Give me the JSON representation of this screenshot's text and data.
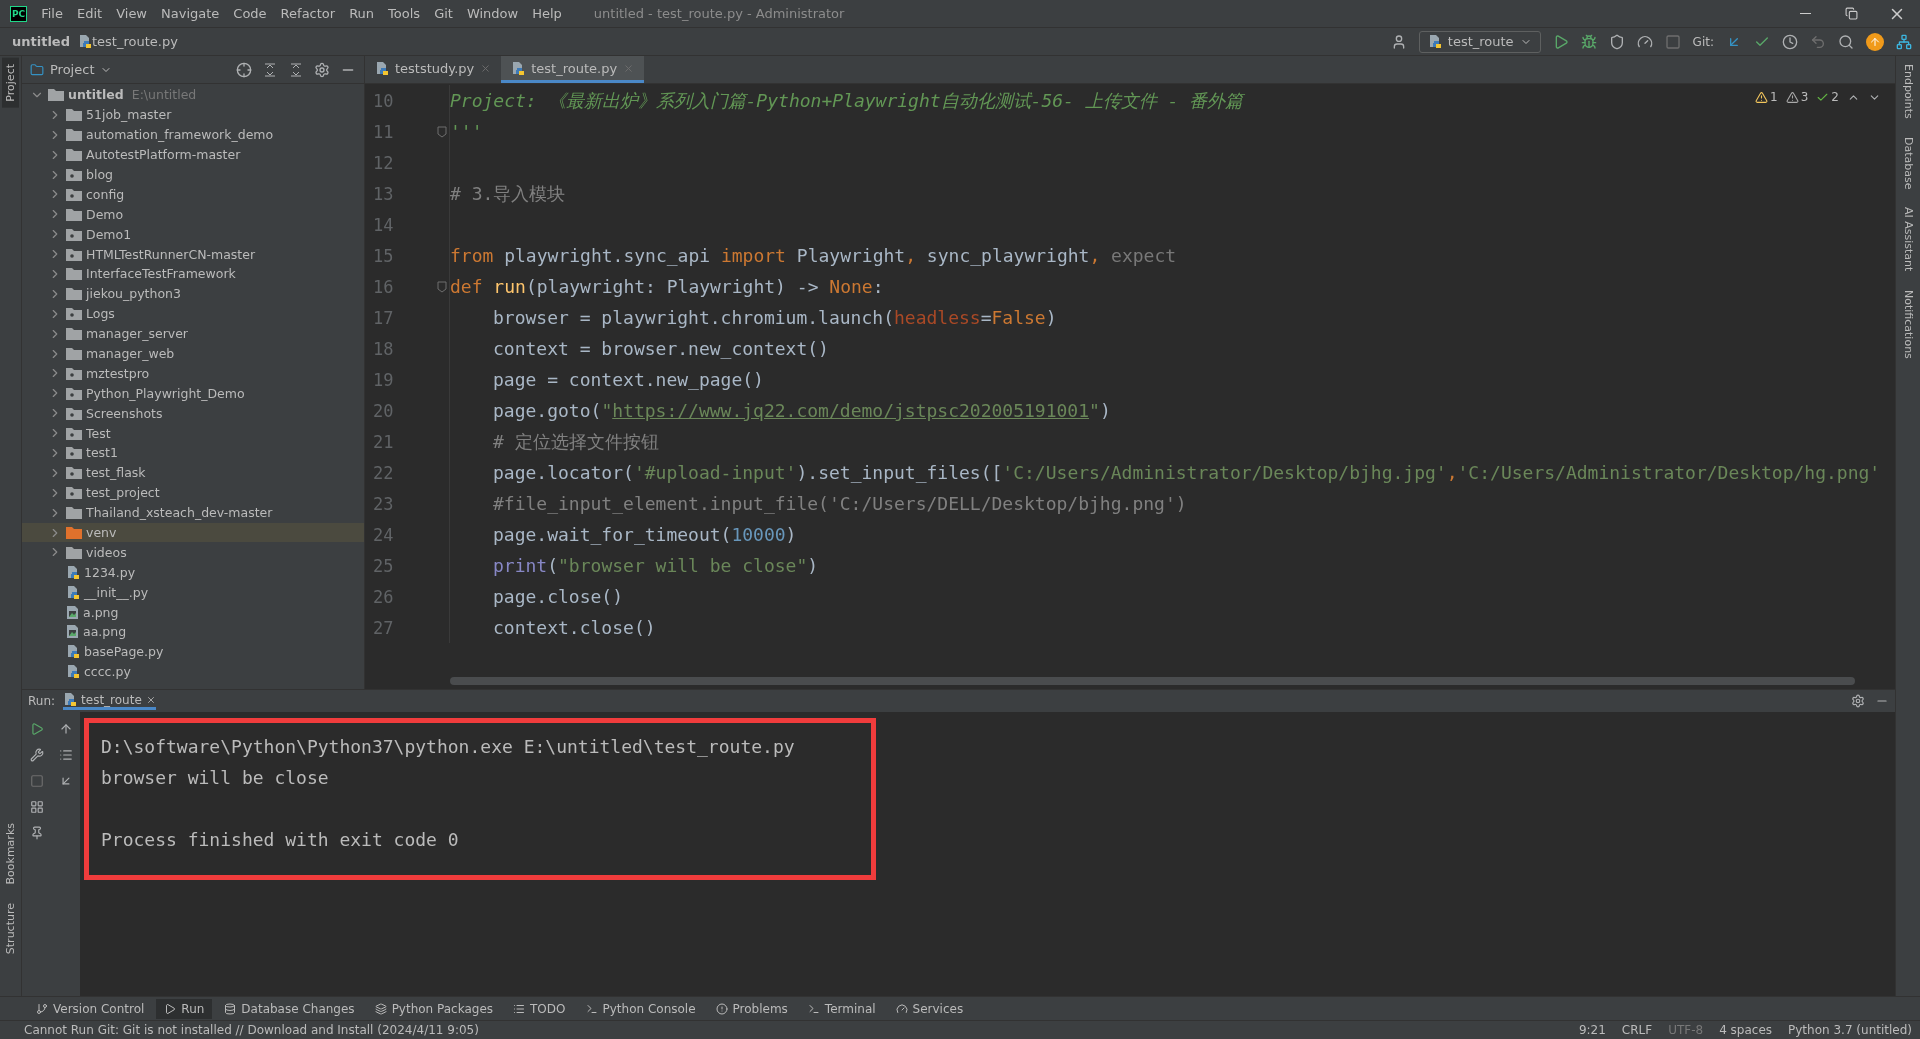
{
  "window": {
    "logo": "PC",
    "title": "untitled - test_route.py - Administrator"
  },
  "menu": [
    "File",
    "Edit",
    "View",
    "Navigate",
    "Code",
    "Refactor",
    "Run",
    "Tools",
    "Git",
    "Window",
    "Help"
  ],
  "breadcrumb": [
    "untitled",
    "test_route.py"
  ],
  "toolbar": {
    "run_config": "test_route",
    "git_label": "Git:"
  },
  "left_strip": [
    {
      "label": "Project",
      "selected": true
    },
    {
      "label": "Bookmarks",
      "selected": false
    },
    {
      "label": "Structure",
      "selected": false
    }
  ],
  "project_panel": {
    "title": "Project",
    "tree": {
      "name": "untitled",
      "path": "E:\\untitled",
      "expanded": true,
      "children": [
        {
          "name": "51job_master",
          "kind": "folder",
          "expanded": false,
          "selected": false
        },
        {
          "name": "automation_framework_demo",
          "kind": "folder",
          "expanded": false,
          "selected": false
        },
        {
          "name": "AutotestPlatform-master",
          "kind": "folder",
          "expanded": false,
          "selected": false
        },
        {
          "name": "blog",
          "kind": "package",
          "expanded": false,
          "selected": false
        },
        {
          "name": "config",
          "kind": "package",
          "expanded": false,
          "selected": false
        },
        {
          "name": "Demo",
          "kind": "folder",
          "expanded": false,
          "selected": false
        },
        {
          "name": "Demo1",
          "kind": "package",
          "expanded": false,
          "selected": false
        },
        {
          "name": "HTMLTestRunnerCN-master",
          "kind": "package",
          "expanded": false,
          "selected": false
        },
        {
          "name": "InterfaceTestFramework",
          "kind": "folder",
          "expanded": false,
          "selected": false
        },
        {
          "name": "jiekou_python3",
          "kind": "folder",
          "expanded": false,
          "selected": false
        },
        {
          "name": "Logs",
          "kind": "package",
          "expanded": false,
          "selected": false
        },
        {
          "name": "manager_server",
          "kind": "folder",
          "expanded": false,
          "selected": false
        },
        {
          "name": "manager_web",
          "kind": "folder",
          "expanded": false,
          "selected": false
        },
        {
          "name": "mztestpro",
          "kind": "package",
          "expanded": false,
          "selected": false
        },
        {
          "name": "Python_Playwright_Demo",
          "kind": "package",
          "expanded": false,
          "selected": false
        },
        {
          "name": "Screenshots",
          "kind": "package",
          "expanded": false,
          "selected": false
        },
        {
          "name": "Test",
          "kind": "package",
          "expanded": false,
          "selected": false
        },
        {
          "name": "test1",
          "kind": "package",
          "expanded": false,
          "selected": false
        },
        {
          "name": "test_flask",
          "kind": "package",
          "expanded": false,
          "selected": false
        },
        {
          "name": "test_project",
          "kind": "package",
          "expanded": false,
          "selected": false
        },
        {
          "name": "Thailand_xsteach_dev-master",
          "kind": "folder",
          "expanded": false,
          "selected": false
        },
        {
          "name": "venv",
          "kind": "excluded",
          "expanded": false,
          "selected": true
        },
        {
          "name": "videos",
          "kind": "folder",
          "expanded": false,
          "selected": false
        },
        {
          "name": "1234.py",
          "kind": "python",
          "selected": false
        },
        {
          "name": "__init__.py",
          "kind": "python",
          "selected": false
        },
        {
          "name": "a.png",
          "kind": "image",
          "selected": false
        },
        {
          "name": "aa.png",
          "kind": "image",
          "selected": false
        },
        {
          "name": "basePage.py",
          "kind": "python",
          "selected": false
        },
        {
          "name": "cccc.py",
          "kind": "python",
          "selected": false
        }
      ]
    }
  },
  "editor": {
    "tabs": [
      {
        "label": "teststudy.py",
        "selected": false
      },
      {
        "label": "test_route.py",
        "selected": true
      }
    ],
    "inspections": [
      {
        "kind": "warning",
        "count": "1"
      },
      {
        "kind": "weak",
        "count": "3"
      },
      {
        "kind": "typo",
        "count": "2"
      }
    ],
    "lines": [
      {
        "number": "10",
        "indented": false,
        "tokens": [
          {
            "text": "Project: 《最新出炉》系列入门篇-Python+Playwright自动化测试-56- 上传文件 - 番外篇",
            "kind": "doc"
          }
        ]
      },
      {
        "number": "11",
        "indented": false,
        "fold": true,
        "tokens": [
          {
            "text": "'''",
            "kind": "doc"
          }
        ]
      },
      {
        "number": "12"
      },
      {
        "number": "13",
        "indented": false,
        "tokens": [
          {
            "text": "# 3.导入模块",
            "kind": "comment"
          }
        ]
      },
      {
        "number": "14"
      },
      {
        "number": "15",
        "indented": false,
        "tokens": [
          {
            "text": "from",
            "kind": "keyword"
          },
          {
            "text": " playwright.sync_api ",
            "kind": "plain"
          },
          {
            "text": "import",
            "kind": "keyword"
          },
          {
            "text": " Playwright",
            "kind": "plain"
          },
          {
            "text": ",",
            "kind": "keyword"
          },
          {
            "text": " sync_playwright",
            "kind": "plain"
          },
          {
            "text": ",",
            "kind": "keyword"
          },
          {
            "text": " expect",
            "kind": "dim"
          }
        ]
      },
      {
        "number": "16",
        "indented": false,
        "fold": true,
        "tokens": [
          {
            "text": "def ",
            "kind": "keyword"
          },
          {
            "text": "run",
            "kind": "function"
          },
          {
            "text": "(playwright: Playwright) -> ",
            "kind": "plain"
          },
          {
            "text": "None",
            "kind": "keyword"
          },
          {
            "text": ":",
            "kind": "plain"
          }
        ]
      },
      {
        "number": "17",
        "indented": true,
        "tokens": [
          {
            "text": "browser = playwright.chromium.launch(",
            "kind": "plain"
          },
          {
            "text": "headless",
            "kind": "param"
          },
          {
            "text": "=",
            "kind": "plain"
          },
          {
            "text": "False",
            "kind": "keyword"
          },
          {
            "text": ")",
            "kind": "plain"
          }
        ]
      },
      {
        "number": "18",
        "indented": true,
        "tokens": [
          {
            "text": "context = browser.new_context()",
            "kind": "plain"
          }
        ]
      },
      {
        "number": "19",
        "indented": true,
        "tokens": [
          {
            "text": "page = context.new_page()",
            "kind": "plain"
          }
        ]
      },
      {
        "number": "20",
        "indented": true,
        "tokens": [
          {
            "text": "page.goto(",
            "kind": "plain"
          },
          {
            "text": "\"",
            "kind": "string"
          },
          {
            "text": "https://www.jq22.com/demo/jstpsc202005191001",
            "kind": "link"
          },
          {
            "text": "\"",
            "kind": "string"
          },
          {
            "text": ")",
            "kind": "plain"
          }
        ]
      },
      {
        "number": "21",
        "indented": true,
        "tokens": [
          {
            "text": "# 定位选择文件按钮",
            "kind": "comment"
          }
        ]
      },
      {
        "number": "22",
        "indented": true,
        "tokens": [
          {
            "text": "page.locator(",
            "kind": "plain"
          },
          {
            "text": "'#upload-input'",
            "kind": "string"
          },
          {
            "text": ").set_input_files([",
            "kind": "plain"
          },
          {
            "text": "'C:/Users/Administrator/Desktop/bjhg.jpg'",
            "kind": "string"
          },
          {
            "text": ",",
            "kind": "keyword"
          },
          {
            "text": "'C:/Users/Administrator/Desktop/hg.png'",
            "kind": "string"
          }
        ]
      },
      {
        "number": "23",
        "indented": true,
        "tokens": [
          {
            "text": "#file_input_element.input_file('C:/Users/DELL/Desktop/bjhg.png')",
            "kind": "comment"
          }
        ]
      },
      {
        "number": "24",
        "indented": true,
        "tokens": [
          {
            "text": "page.wait_for_timeout(",
            "kind": "plain"
          },
          {
            "text": "10000",
            "kind": "number"
          },
          {
            "text": ")",
            "kind": "plain"
          }
        ]
      },
      {
        "number": "25",
        "indented": true,
        "tokens": [
          {
            "text": "print",
            "kind": "builtin"
          },
          {
            "text": "(",
            "kind": "plain"
          },
          {
            "text": "\"browser will be close\"",
            "kind": "string"
          },
          {
            "text": ")",
            "kind": "plain"
          }
        ]
      },
      {
        "number": "26",
        "indented": true,
        "tokens": [
          {
            "text": "page.close()",
            "kind": "plain"
          }
        ]
      },
      {
        "number": "27",
        "indented": true,
        "tokens": [
          {
            "text": "context.close()",
            "kind": "plain"
          }
        ]
      }
    ]
  },
  "right_strip": [
    "Endpoints",
    "Database",
    "AI Assistant",
    "Notifications"
  ],
  "run_panel": {
    "label": "Run:",
    "tab": "test_route",
    "command": "D:\\software\\Python\\Python37\\python.exe E:\\untitled\\test_route.py",
    "output": "browser will be close",
    "exit_message": "Process finished with exit code 0"
  },
  "tool_tabs": [
    {
      "label": "Version Control",
      "kind": "vcs",
      "selected": false
    },
    {
      "label": "Run",
      "kind": "run",
      "selected": true
    },
    {
      "label": "Database Changes",
      "kind": "database",
      "selected": false
    },
    {
      "label": "Python Packages",
      "kind": "packages",
      "selected": false
    },
    {
      "label": "TODO",
      "kind": "todo",
      "selected": false
    },
    {
      "label": "Python Console",
      "kind": "console",
      "selected": false
    },
    {
      "label": "Problems",
      "kind": "problems",
      "selected": false
    },
    {
      "label": "Terminal",
      "kind": "terminal",
      "selected": false
    },
    {
      "label": "Services",
      "kind": "services",
      "selected": false
    }
  ],
  "status_bar": {
    "message": "Cannot Run Git: Git is not installed // Download and Install (2024/4/11 9:05)",
    "items": [
      "9:21",
      "CRLF",
      "UTF-8",
      "4 spaces",
      "Python 3.7 (untitled)"
    ]
  }
}
